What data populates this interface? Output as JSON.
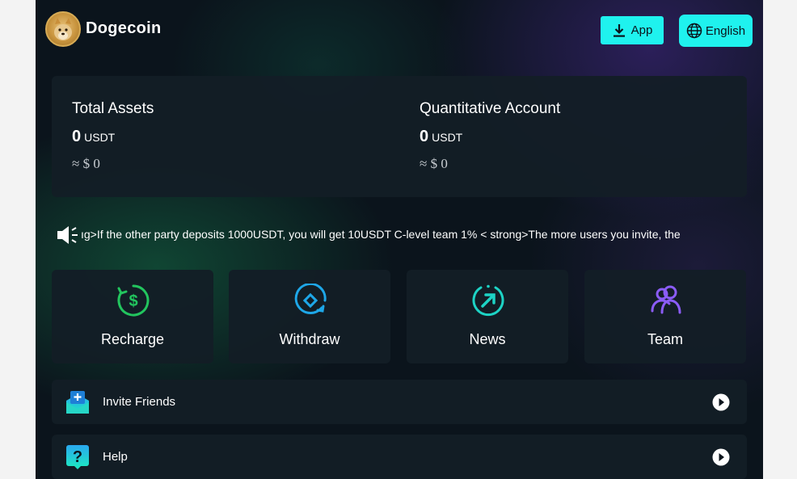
{
  "header": {
    "brand": "Dogecoin",
    "app_button": "App",
    "language_button": "English"
  },
  "assets": {
    "total": {
      "title": "Total Assets",
      "value": "0",
      "unit": "USDT",
      "approx": "≈ $ 0"
    },
    "quant": {
      "title": "Quantitative Account",
      "value": "0",
      "unit": "USDT",
      "approx": "≈ $ 0"
    }
  },
  "notice": {
    "text": "ıg>If the other party deposits 1000USDT, you will get 10USDT C-level team 1% < strong>The more users you invite, the"
  },
  "tiles": [
    {
      "label": "Recharge",
      "icon": "recharge-icon",
      "color": "#22c55e"
    },
    {
      "label": "Withdraw",
      "icon": "withdraw-icon",
      "color": "#1ea7e8"
    },
    {
      "label": "News",
      "icon": "news-icon",
      "color": "#1dd3c5"
    },
    {
      "label": "Team",
      "icon": "team-icon",
      "color": "#8b5cf6"
    }
  ],
  "rows": [
    {
      "label": "Invite Friends",
      "icon": "invite-icon"
    },
    {
      "label": "Help",
      "icon": "help-icon"
    }
  ],
  "colors": {
    "accent": "#1ff2ee",
    "background": "#0b141c",
    "card": "#131e26"
  }
}
